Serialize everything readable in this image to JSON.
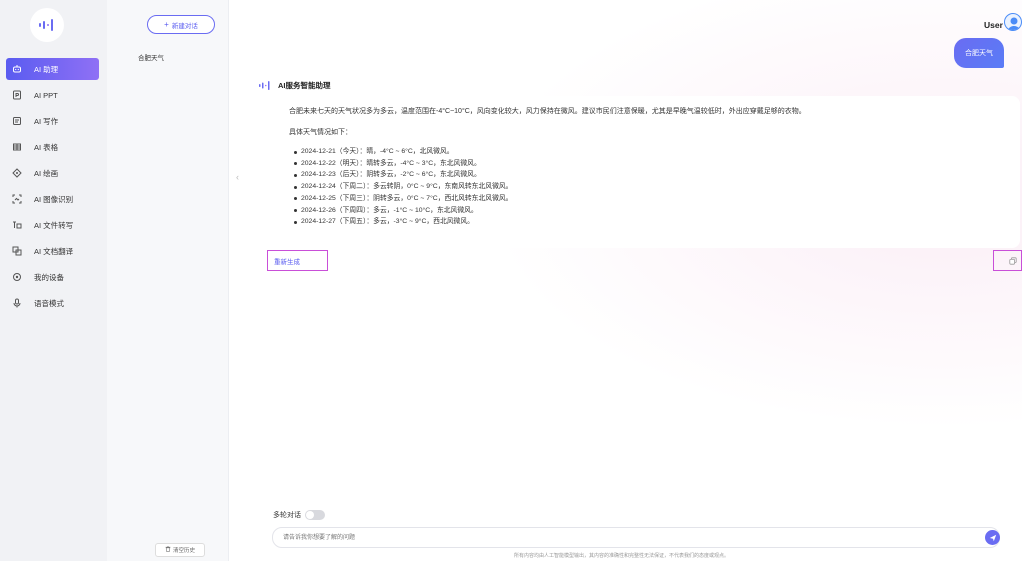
{
  "nav": {
    "items": [
      {
        "label": "AI 助理",
        "icon": "robot-icon",
        "active": true
      },
      {
        "label": "AI PPT",
        "icon": "ppt-icon",
        "active": false
      },
      {
        "label": "AI 写作",
        "icon": "write-icon",
        "active": false
      },
      {
        "label": "AI 表格",
        "icon": "table-icon",
        "active": false
      },
      {
        "label": "AI 绘画",
        "icon": "paint-icon",
        "active": false
      },
      {
        "label": "AI 图像识别",
        "icon": "image-scan-icon",
        "active": false
      },
      {
        "label": "AI 文件转写",
        "icon": "file-transcribe-icon",
        "active": false
      },
      {
        "label": "AI 文档翻译",
        "icon": "translate-icon",
        "active": false
      },
      {
        "label": "我的设备",
        "icon": "device-icon",
        "active": false
      },
      {
        "label": "语音模式",
        "icon": "mic-icon",
        "active": false
      }
    ]
  },
  "history": {
    "new_chat_label": "新建对话",
    "items": [
      "合肥天气"
    ],
    "clear_label": "清空历史"
  },
  "header": {
    "user_name": "User"
  },
  "chat": {
    "user_message": "合肥天气",
    "assistant_name": "AI服务智能助理",
    "intro": "合肥未来七天的天气状况多为多云，温度范围在-4°C~10°C，风向变化较大，风力保持在微风。建议市民们注意保暖，尤其是早晚气温较低时，外出应穿戴足够的衣物。",
    "sub_heading": "具体天气情况如下：",
    "forecast": [
      "2024-12-21（今天）：晴，-4°C ~ 6°C，北风微风。",
      "2024-12-22（明天）：晴转多云，-4°C ~ 3°C，东北风微风。",
      "2024-12-23（后天）：阴转多云，-2°C ~ 6°C，东北风微风。",
      "2024-12-24（下周二）：多云转阴，0°C ~ 9°C，东南风转东北风微风。",
      "2024-12-25（下周三）：阴转多云，0°C ~ 7°C，西北风转东北风微风。",
      "2024-12-26（下周四）：多云，-1°C ~ 10°C，东北风微风。",
      "2024-12-27（下周五）：多云，-3°C ~ 9°C，西北风微风。"
    ],
    "regenerate_label": "重新生成"
  },
  "composer": {
    "multi_turn_label": "多轮对话",
    "multi_turn_enabled": false,
    "placeholder": "请告诉我你想要了解的问题",
    "disclaimer": "所有内容均由人工智能模型输出，其内容的准确性和完整性无法保证，不代表我们的态度或观点。"
  },
  "colors": {
    "accent": "#6a6cf2",
    "highlight_border": "#c94fd8"
  }
}
